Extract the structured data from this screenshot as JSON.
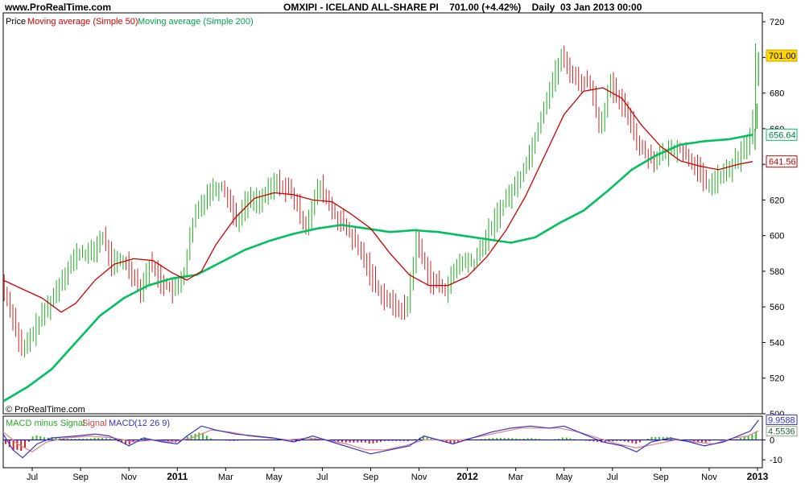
{
  "header": {
    "site": "www.ProRealTime.com",
    "title": "OMXIPI - ICELAND ALL-SHARE PI    701.00 (+4.42%)    Daily  03 Jan 2013 00:00"
  },
  "colors": {
    "ma50": "#cc0000",
    "ma200": "#00c060",
    "up": "#22aa22",
    "down": "#cc2222",
    "macd": "#3333cc",
    "signal": "#e08080",
    "histogram": "#33bb33",
    "zero": "#0000cc",
    "last_bg": "#ffd700"
  },
  "chart_data": [
    {
      "type": "line",
      "legend": {
        "price": "Price",
        "ma50": "Moving average (Simple 50)",
        "ma200": "Moving average (Simple 200)"
      },
      "watermark": "© ProRealTime.com",
      "ylim": [
        500,
        725
      ],
      "y_ticks": [
        500,
        520,
        540,
        560,
        580,
        600,
        620,
        640,
        660,
        680,
        700,
        720
      ],
      "x_ticks": [
        {
          "t": 0.6,
          "label": "Jul",
          "bold": false
        },
        {
          "t": 1.6,
          "label": "Sep",
          "bold": false
        },
        {
          "t": 2.6,
          "label": "Nov",
          "bold": false
        },
        {
          "t": 3.6,
          "label": "2011",
          "bold": true
        },
        {
          "t": 4.6,
          "label": "Mar",
          "bold": false
        },
        {
          "t": 5.6,
          "label": "May",
          "bold": false
        },
        {
          "t": 6.6,
          "label": "Jul",
          "bold": false
        },
        {
          "t": 7.6,
          "label": "Sep",
          "bold": false
        },
        {
          "t": 8.6,
          "label": "Nov",
          "bold": false
        },
        {
          "t": 9.6,
          "label": "2012",
          "bold": true
        },
        {
          "t": 10.6,
          "label": "Mar",
          "bold": false
        },
        {
          "t": 11.6,
          "label": "May",
          "bold": false
        },
        {
          "t": 12.6,
          "label": "Jul",
          "bold": false
        },
        {
          "t": 13.6,
          "label": "Sep",
          "bold": false
        },
        {
          "t": 14.6,
          "label": "Nov",
          "bold": false
        },
        {
          "t": 15.6,
          "label": "2013",
          "bold": true
        }
      ],
      "price": [
        [
          0,
          575
        ],
        [
          0.25,
          555
        ],
        [
          0.45,
          534
        ],
        [
          0.8,
          552
        ],
        [
          1.1,
          566
        ],
        [
          1.3,
          578
        ],
        [
          1.6,
          590
        ],
        [
          1.9,
          590
        ],
        [
          2.1,
          600
        ],
        [
          2.3,
          585
        ],
        [
          2.6,
          585
        ],
        [
          2.9,
          570
        ],
        [
          3.1,
          585
        ],
        [
          3.3,
          575
        ],
        [
          3.6,
          568
        ],
        [
          3.8,
          580
        ],
        [
          4.0,
          610
        ],
        [
          4.3,
          625
        ],
        [
          4.6,
          628
        ],
        [
          4.9,
          608
        ],
        [
          5.1,
          620
        ],
        [
          5.4,
          620
        ],
        [
          5.7,
          630
        ],
        [
          6.0,
          625
        ],
        [
          6.3,
          605
        ],
        [
          6.6,
          628
        ],
        [
          6.9,
          612
        ],
        [
          7.2,
          602
        ],
        [
          7.5,
          588
        ],
        [
          7.8,
          570
        ],
        [
          8.1,
          561
        ],
        [
          8.4,
          558
        ],
        [
          8.6,
          597
        ],
        [
          8.9,
          575
        ],
        [
          9.2,
          570
        ],
        [
          9.5,
          585
        ],
        [
          9.8,
          585
        ],
        [
          10.1,
          602
        ],
        [
          10.4,
          618
        ],
        [
          10.7,
          630
        ],
        [
          11.0,
          650
        ],
        [
          11.3,
          678
        ],
        [
          11.6,
          700
        ],
        [
          11.9,
          688
        ],
        [
          12.2,
          685
        ],
        [
          12.4,
          660
        ],
        [
          12.6,
          685
        ],
        [
          12.8,
          675
        ],
        [
          13.0,
          668
        ],
        [
          13.2,
          650
        ],
        [
          13.5,
          643
        ],
        [
          13.7,
          645
        ],
        [
          14.0,
          650
        ],
        [
          14.3,
          642
        ],
        [
          14.6,
          628
        ],
        [
          14.9,
          633
        ],
        [
          15.1,
          638
        ],
        [
          15.3,
          645
        ],
        [
          15.5,
          655
        ],
        [
          15.6,
          672
        ],
        [
          15.62,
          701
        ]
      ],
      "ma50": [
        [
          0,
          575
        ],
        [
          0.4,
          570
        ],
        [
          0.8,
          565
        ],
        [
          1.2,
          557
        ],
        [
          1.5,
          562
        ],
        [
          1.9,
          575
        ],
        [
          2.3,
          584
        ],
        [
          2.7,
          587
        ],
        [
          3.1,
          586
        ],
        [
          3.5,
          579
        ],
        [
          3.8,
          575
        ],
        [
          4.1,
          580
        ],
        [
          4.4,
          595
        ],
        [
          4.8,
          610
        ],
        [
          5.2,
          621
        ],
        [
          5.6,
          624
        ],
        [
          6.0,
          623
        ],
        [
          6.4,
          620
        ],
        [
          6.8,
          619
        ],
        [
          7.2,
          612
        ],
        [
          7.6,
          604
        ],
        [
          8.0,
          590
        ],
        [
          8.4,
          578
        ],
        [
          8.8,
          572
        ],
        [
          9.2,
          572
        ],
        [
          9.6,
          577
        ],
        [
          10.0,
          588
        ],
        [
          10.4,
          603
        ],
        [
          10.8,
          622
        ],
        [
          11.2,
          645
        ],
        [
          11.6,
          668
        ],
        [
          12.0,
          681
        ],
        [
          12.4,
          683
        ],
        [
          12.8,
          677
        ],
        [
          13.2,
          662
        ],
        [
          13.6,
          650
        ],
        [
          14.0,
          642
        ],
        [
          14.4,
          639
        ],
        [
          14.8,
          637
        ],
        [
          15.2,
          640
        ],
        [
          15.5,
          641.56
        ]
      ],
      "ma200": [
        [
          0,
          507
        ],
        [
          0.5,
          515
        ],
        [
          1.0,
          525
        ],
        [
          1.5,
          540
        ],
        [
          2.0,
          555
        ],
        [
          2.5,
          565
        ],
        [
          3.0,
          572
        ],
        [
          3.5,
          576
        ],
        [
          4.0,
          578
        ],
        [
          4.5,
          585
        ],
        [
          5.0,
          592
        ],
        [
          5.5,
          597
        ],
        [
          6.0,
          601
        ],
        [
          6.5,
          604
        ],
        [
          7.0,
          606
        ],
        [
          7.5,
          604
        ],
        [
          8.0,
          602
        ],
        [
          8.5,
          603
        ],
        [
          9.0,
          602
        ],
        [
          9.5,
          600
        ],
        [
          10.0,
          598
        ],
        [
          10.5,
          596
        ],
        [
          11.0,
          599
        ],
        [
          11.5,
          607
        ],
        [
          12.0,
          614
        ],
        [
          12.5,
          625
        ],
        [
          13.0,
          637
        ],
        [
          13.5,
          645
        ],
        [
          14.0,
          651
        ],
        [
          14.5,
          653
        ],
        [
          15.0,
          654
        ],
        [
          15.5,
          656.64
        ]
      ],
      "last_values": {
        "price": "701.00",
        "ma200": "656.64",
        "ma50": "641.56"
      }
    },
    {
      "type": "line",
      "legend": {
        "hist": "MACD minus Signal",
        "signal": "Signal",
        "macd": "MACD",
        "params": "(12 26 9)"
      },
      "ylim": [
        -14,
        12
      ],
      "y_ticks": [
        0,
        -10
      ],
      "macd": [
        [
          0,
          3
        ],
        [
          0.2,
          -5
        ],
        [
          0.4,
          -9
        ],
        [
          0.7,
          -2
        ],
        [
          1.0,
          1
        ],
        [
          1.5,
          2
        ],
        [
          1.9,
          3
        ],
        [
          2.2,
          2
        ],
        [
          2.6,
          -3
        ],
        [
          2.9,
          1
        ],
        [
          3.3,
          -1
        ],
        [
          3.6,
          -2
        ],
        [
          3.8,
          2
        ],
        [
          4.1,
          7
        ],
        [
          4.4,
          5
        ],
        [
          4.8,
          3
        ],
        [
          5.2,
          2
        ],
        [
          5.6,
          1
        ],
        [
          6.0,
          -1
        ],
        [
          6.4,
          2
        ],
        [
          6.8,
          -1
        ],
        [
          7.2,
          -4
        ],
        [
          7.6,
          -7
        ],
        [
          8.0,
          -5
        ],
        [
          8.4,
          -3
        ],
        [
          8.7,
          2
        ],
        [
          9.0,
          0
        ],
        [
          9.3,
          -2
        ],
        [
          9.7,
          1
        ],
        [
          10.1,
          4
        ],
        [
          10.5,
          6
        ],
        [
          10.9,
          7
        ],
        [
          11.3,
          6
        ],
        [
          11.6,
          7
        ],
        [
          12.0,
          3
        ],
        [
          12.4,
          -1
        ],
        [
          12.8,
          -3
        ],
        [
          13.1,
          -6
        ],
        [
          13.4,
          -1
        ],
        [
          13.8,
          1
        ],
        [
          14.2,
          -1
        ],
        [
          14.5,
          -3
        ],
        [
          14.9,
          -1
        ],
        [
          15.2,
          2
        ],
        [
          15.45,
          4.5
        ],
        [
          15.62,
          9.9588
        ]
      ],
      "signal": [
        [
          0,
          4
        ],
        [
          0.3,
          -2
        ],
        [
          0.6,
          -6
        ],
        [
          0.9,
          -1
        ],
        [
          1.3,
          1
        ],
        [
          1.8,
          2
        ],
        [
          2.3,
          1
        ],
        [
          2.7,
          -1
        ],
        [
          3.1,
          0
        ],
        [
          3.5,
          -1
        ],
        [
          3.9,
          1
        ],
        [
          4.3,
          5
        ],
        [
          4.7,
          4
        ],
        [
          5.1,
          2
        ],
        [
          5.5,
          1
        ],
        [
          5.9,
          0
        ],
        [
          6.3,
          1
        ],
        [
          6.7,
          0
        ],
        [
          7.1,
          -2
        ],
        [
          7.5,
          -5
        ],
        [
          7.9,
          -5
        ],
        [
          8.3,
          -3
        ],
        [
          8.7,
          0
        ],
        [
          9.1,
          0
        ],
        [
          9.5,
          0
        ],
        [
          9.9,
          2
        ],
        [
          10.3,
          4
        ],
        [
          10.7,
          6
        ],
        [
          11.1,
          6
        ],
        [
          11.5,
          6
        ],
        [
          11.9,
          4
        ],
        [
          12.3,
          1
        ],
        [
          12.7,
          -2
        ],
        [
          13.1,
          -4
        ],
        [
          13.5,
          -2
        ],
        [
          13.9,
          0
        ],
        [
          14.3,
          -1
        ],
        [
          14.7,
          -2
        ],
        [
          15.1,
          1
        ],
        [
          15.4,
          2
        ],
        [
          15.62,
          4.5536
        ]
      ],
      "last_values": {
        "macd": "9.9588",
        "signal": "4.5536"
      }
    }
  ]
}
